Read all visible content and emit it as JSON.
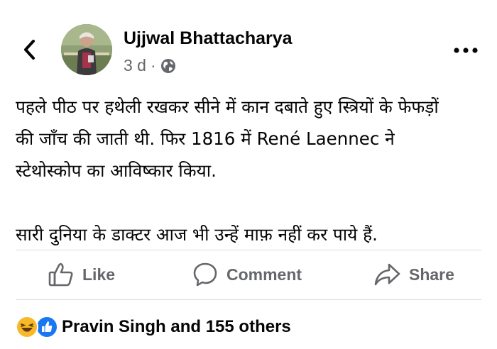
{
  "header": {
    "back_icon": "chevron-left-icon",
    "author_name": "Ujjwal Bhattacharya",
    "timestamp": "3 d",
    "separator": "·",
    "audience_icon": "globe-icon",
    "more_icon": "more-horizontal-icon"
  },
  "post": {
    "paragraph1_lines": [
      "पहले पीठ पर हथेली रखकर सीने में कान दबाते हुए स्त्रियों के फेफड़ों",
      "की जाँच की जाती थी. फिर 1816 में René Laennec ने",
      "स्टेथोस्कोप का आविष्कार किया."
    ],
    "paragraph2": "सारी दुनिया के डाक्टर आज भी उन्हें माफ़ नहीं कर पाये हैं."
  },
  "actions": {
    "like_label": "Like",
    "like_icon": "thumbs-up-icon",
    "comment_label": "Comment",
    "comment_icon": "comment-bubble-icon",
    "share_label": "Share",
    "share_icon": "share-arrow-icon"
  },
  "reactions": {
    "icons": [
      "haha-emoji-icon",
      "like-reaction-icon"
    ],
    "summary": "Pravin Singh and 155 others"
  },
  "colors": {
    "secondary_text": "#65676b",
    "primary_text": "#050505",
    "divider": "#dadde1",
    "like_blue": "#1877f2",
    "haha_yellow": "#f7b928"
  }
}
